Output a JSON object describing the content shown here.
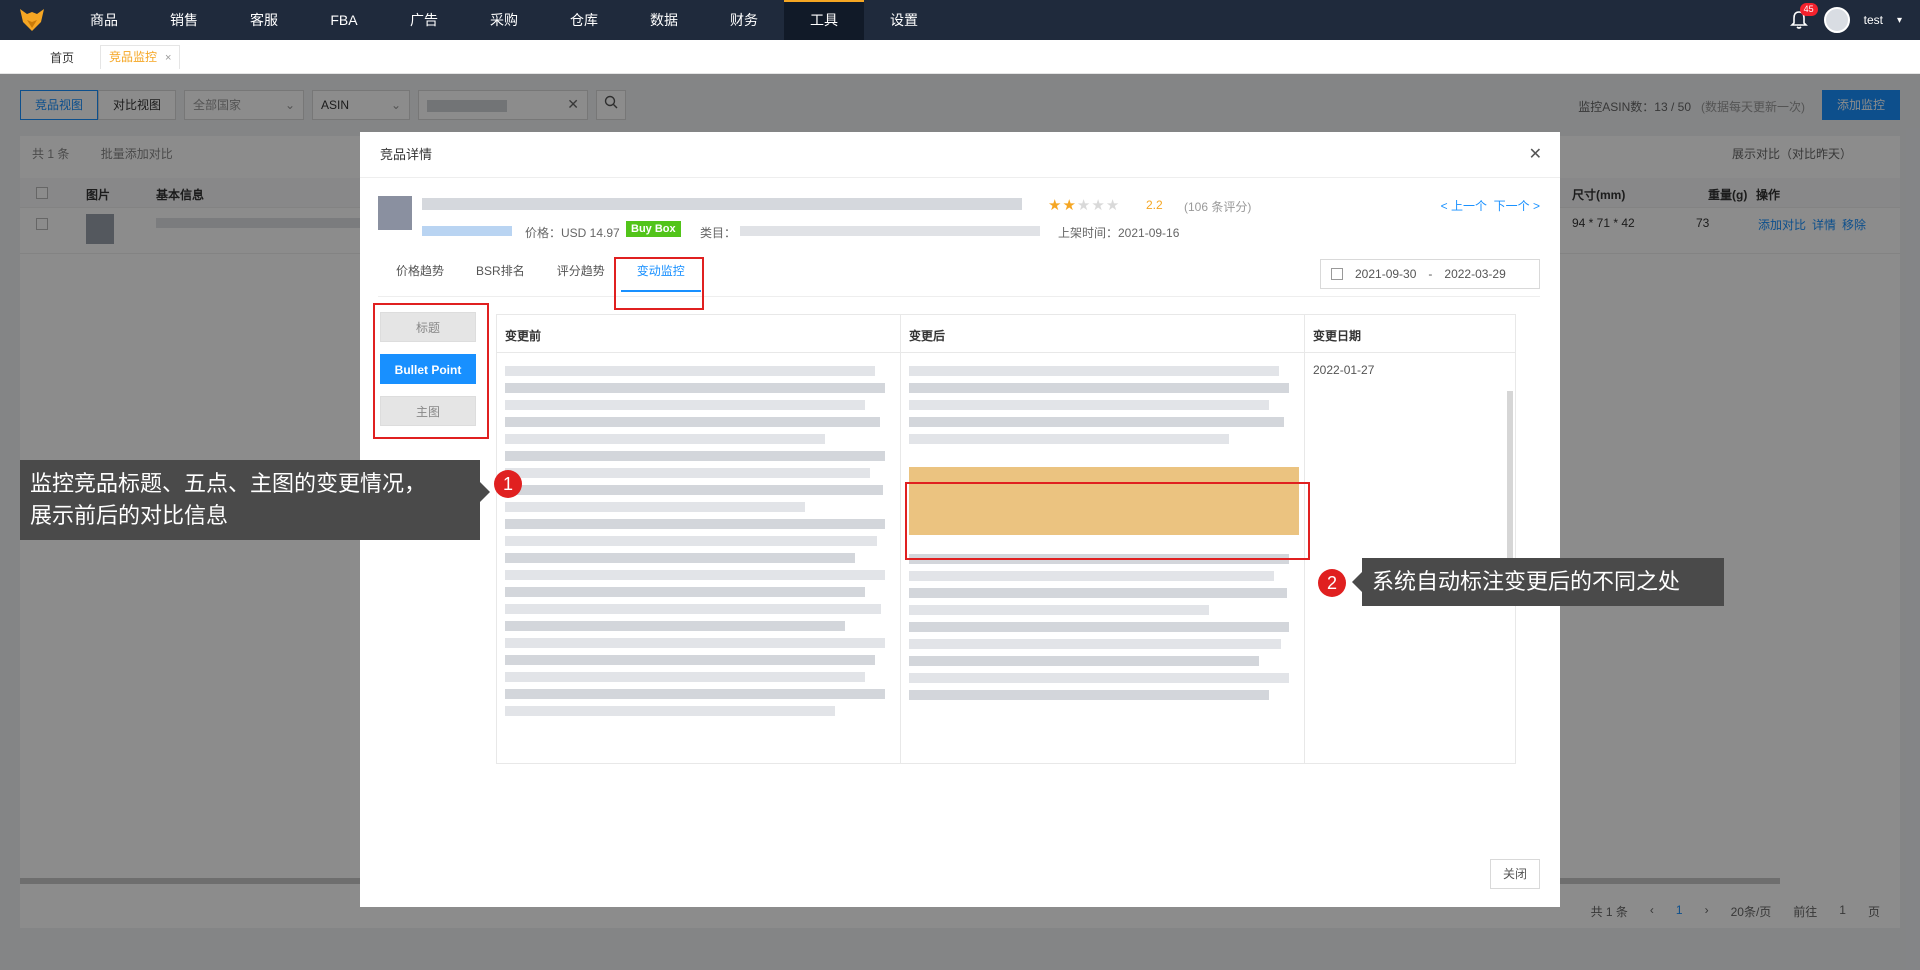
{
  "nav": {
    "items": [
      "商品",
      "销售",
      "客服",
      "FBA",
      "广告",
      "采购",
      "仓库",
      "数据",
      "财务",
      "工具",
      "设置"
    ],
    "active": "工具",
    "notify_count": "45",
    "user": "test"
  },
  "tabs": {
    "home": "首页",
    "current": "竞品监控",
    "close": "×"
  },
  "toolbar": {
    "view_product": "竞品视图",
    "view_compare": "对比视图",
    "country_placeholder": "全部国家",
    "field": "ASIN",
    "monitor_label": "监控ASIN数：13 / 50",
    "monitor_sub": "(数据每天更新一次)",
    "add_monitor": "添加监控"
  },
  "panel": {
    "count": "共 1 条",
    "batch": "批量添加对比",
    "show_compare": "展示对比（对比昨天）",
    "headers": [
      "图片",
      "基本信息",
      "尺寸(mm)",
      "重量(g)",
      "操作"
    ],
    "row": {
      "size": "94 * 71 * 42",
      "weight": "73",
      "actions": [
        "添加对比",
        "详情",
        "移除"
      ]
    },
    "pager": {
      "total": "共 1 条",
      "page": "1",
      "per_page": "20条/页",
      "goto": "前往",
      "goto_page": "1",
      "page_unit": "页"
    }
  },
  "modal": {
    "title": "竞品详情",
    "close_icon": "close-icon",
    "price": "价格：USD 14.97",
    "buybox": "Buy Box",
    "category_label": "类目：",
    "rating": "2.2",
    "reviews": "(106 条评分)",
    "listed": "上架时间：2021-09-16",
    "prev": "< 上一个",
    "next": "下一个 >",
    "tabs": [
      "价格趋势",
      "BSR排名",
      "评分趋势",
      "变动监控"
    ],
    "active_tab": "变动监控",
    "date_start": "2021-09-30",
    "date_sep": "-",
    "date_end": "2022-03-29",
    "side": [
      "标题",
      "Bullet Point",
      "主图"
    ],
    "active_side": "Bullet Point",
    "table_headers": [
      "变更前",
      "变更后",
      "变更日期"
    ],
    "change_date": "2022-01-27",
    "close_button": "关闭"
  },
  "annotations": {
    "one": {
      "num": "1",
      "text_line1": "监控竞品标题、五点、主图的变更情况，",
      "text_line2": "展示前后的对比信息"
    },
    "two": {
      "num": "2",
      "text": "系统自动标注变更后的不同之处"
    }
  },
  "colors": {
    "nav_bg": "#1f2a3c",
    "accent": "#1890ff",
    "tab_accent": "#f5a623",
    "highlight": "#e02020"
  }
}
